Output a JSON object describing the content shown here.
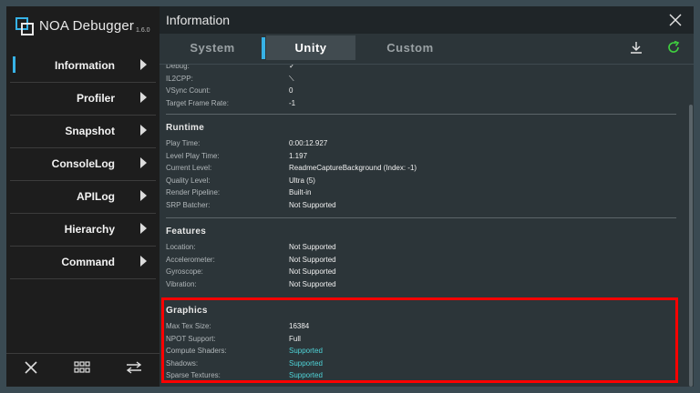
{
  "app": {
    "title": "NOA Debugger",
    "version": "1.6.0"
  },
  "sidebar": {
    "items": [
      {
        "label": "Information",
        "active": true
      },
      {
        "label": "Profiler"
      },
      {
        "label": "Snapshot"
      },
      {
        "label": "ConsoleLog"
      },
      {
        "label": "APILog"
      },
      {
        "label": "Hierarchy"
      },
      {
        "label": "Command"
      }
    ],
    "bottom_icons": [
      "close-icon",
      "grid-icon",
      "swap-arrows-icon"
    ]
  },
  "header": {
    "title": "Information"
  },
  "tabs": [
    {
      "label": "System"
    },
    {
      "label": "Unity",
      "active": true
    },
    {
      "label": "Custom"
    }
  ],
  "colors": {
    "accent": "#37b2e6",
    "supported": "#4fd4d8",
    "highlight": "#ff0000"
  },
  "sections": {
    "top_rows": [
      {
        "key": "Debug:",
        "value": "✓"
      },
      {
        "key": "IL2CPP:",
        "value": "⟍"
      },
      {
        "key": "VSync Count:",
        "value": "0"
      },
      {
        "key": "Target Frame Rate:",
        "value": "-1"
      }
    ],
    "runtime": {
      "title": "Runtime",
      "rows": [
        {
          "key": "Play Time:",
          "value": "0:00:12.927"
        },
        {
          "key": "Level Play Time:",
          "value": "1.197"
        },
        {
          "key": "Current Level:",
          "value": "ReadmeCaptureBackground (Index: -1)"
        },
        {
          "key": "Quality Level:",
          "value": "Ultra (5)"
        },
        {
          "key": "Render Pipeline:",
          "value": "Built-in"
        },
        {
          "key": "SRP Batcher:",
          "value": "Not Supported"
        }
      ]
    },
    "features": {
      "title": "Features",
      "rows": [
        {
          "key": "Location:",
          "value": "Not Supported"
        },
        {
          "key": "Accelerometer:",
          "value": "Not Supported"
        },
        {
          "key": "Gyroscope:",
          "value": "Not Supported"
        },
        {
          "key": "Vibration:",
          "value": "Not Supported"
        }
      ]
    },
    "graphics": {
      "title": "Graphics",
      "rows": [
        {
          "key": "Max Tex Size:",
          "value": "16384"
        },
        {
          "key": "NPOT Support:",
          "value": "Full"
        },
        {
          "key": "Compute Shaders:",
          "value": "Supported"
        },
        {
          "key": "Shadows:",
          "value": "Supported"
        },
        {
          "key": "Sparse Textures:",
          "value": "Supported"
        }
      ]
    }
  }
}
